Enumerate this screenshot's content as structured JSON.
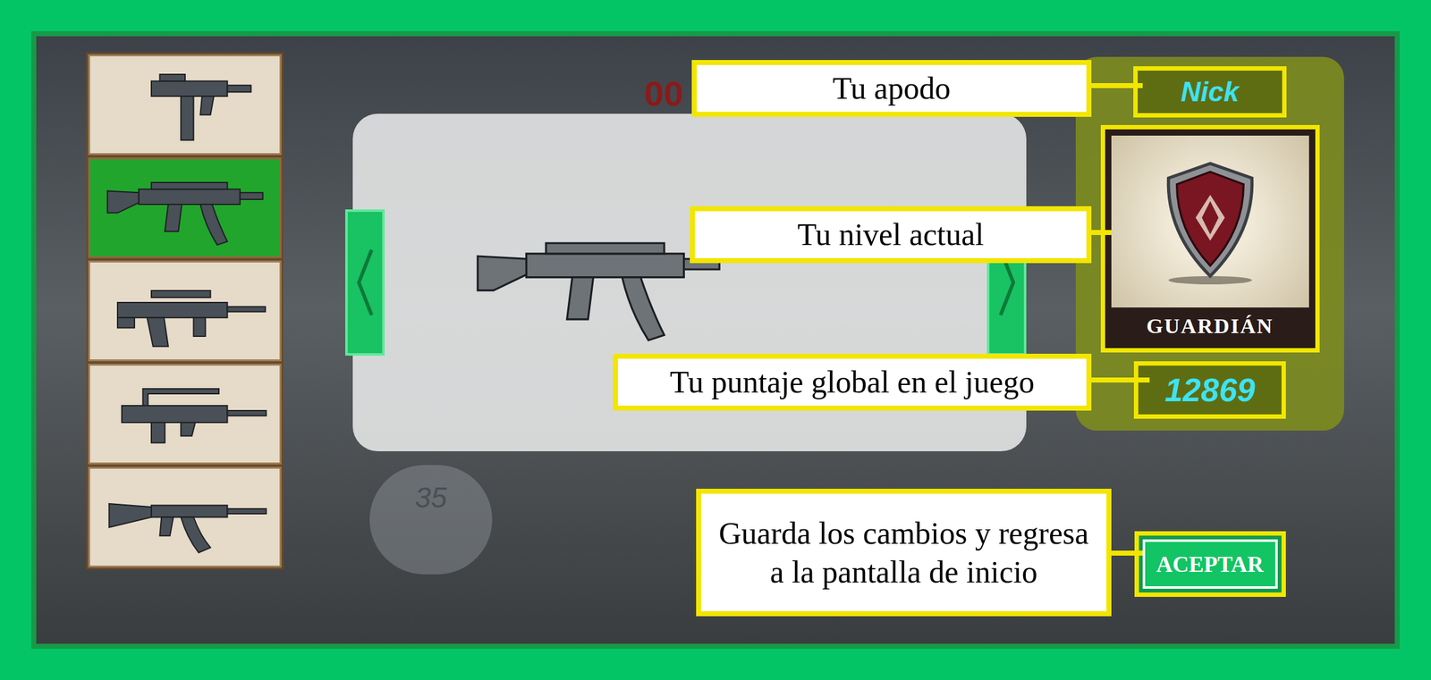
{
  "weapons": [
    {
      "kind": "uzi",
      "selected": false
    },
    {
      "kind": "mp5",
      "selected": true
    },
    {
      "kind": "aug",
      "selected": false
    },
    {
      "kind": "famas",
      "selected": false
    },
    {
      "kind": "ak47",
      "selected": false
    }
  ],
  "hud": {
    "timer": "00",
    "ammo": "35"
  },
  "preview": {
    "kind": "mp5"
  },
  "profile": {
    "nickname": "Nick",
    "level": "GUARDIÁN",
    "score": "12869"
  },
  "callouts": {
    "nickname": "Tu apodo",
    "level": "Tu nivel actual",
    "score": "Tu puntaje global en el juego",
    "accept": "Guarda los cambios y regresa a la pantalla de inicio"
  },
  "buttons": {
    "accept": "ACEPTAR"
  }
}
